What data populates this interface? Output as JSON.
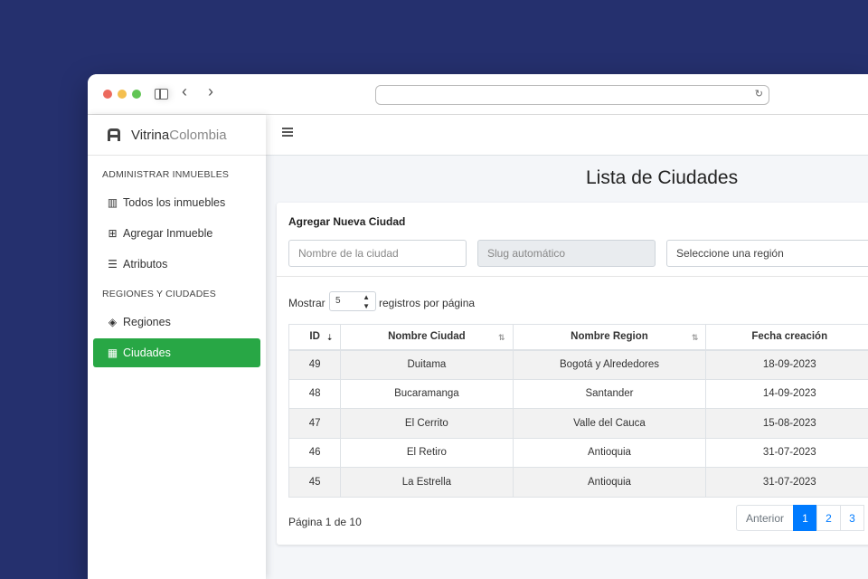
{
  "brand": {
    "name_bold": "Vitrina",
    "name_light": "Colombia"
  },
  "sidebar": {
    "sections": [
      {
        "header": "ADMINISTRAR INMUEBLES"
      },
      {
        "header": "REGIONES Y CIUDADES"
      }
    ],
    "items": [
      {
        "label": "Todos los inmuebles",
        "icon": "building-icon"
      },
      {
        "label": "Agregar Inmueble",
        "icon": "plus-square-icon"
      },
      {
        "label": "Atributos",
        "icon": "list-check-icon"
      },
      {
        "label": "Regiones",
        "icon": "map-regions-icon"
      },
      {
        "label": "Ciudades",
        "icon": "city-icon",
        "active": true
      }
    ]
  },
  "page": {
    "title": "Lista de Ciudades"
  },
  "form": {
    "title": "Agregar Nueva Ciudad",
    "city_placeholder": "Nombre de la ciudad",
    "slug_placeholder": "Slug automático",
    "region_selected": "Seleccione una región"
  },
  "table_controls": {
    "show_label": "Mostrar",
    "page_size": "5",
    "per_page_label": "registros por página"
  },
  "table": {
    "columns": [
      "ID",
      "Nombre Ciudad",
      "Nombre Region",
      "Fecha creación"
    ],
    "rows": [
      [
        "49",
        "Duitama",
        "Bogotá y Alrededores",
        "18-09-2023"
      ],
      [
        "48",
        "Bucaramanga",
        "Santander",
        "14-09-2023"
      ],
      [
        "47",
        "El Cerrito",
        "Valle del Cauca",
        "15-08-2023"
      ],
      [
        "46",
        "El Retiro",
        "Antioquia",
        "31-07-2023"
      ],
      [
        "45",
        "La Estrella",
        "Antioquia",
        "31-07-2023"
      ]
    ]
  },
  "pagination": {
    "info": "Página 1 de 10",
    "prev_label": "Anterior",
    "pages": [
      "1",
      "2",
      "3"
    ],
    "current": "1"
  },
  "colors": {
    "active_nav": "#28a745",
    "primary": "#007bff",
    "backdrop": "#25306e"
  }
}
